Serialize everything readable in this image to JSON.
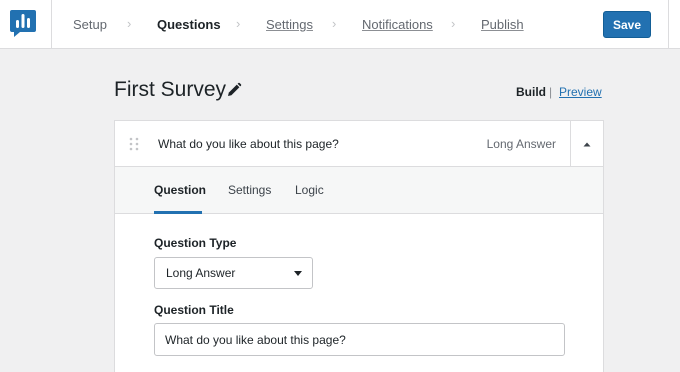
{
  "header": {
    "steps": [
      {
        "label": "Setup",
        "state": "done"
      },
      {
        "label": "Questions",
        "state": "active"
      },
      {
        "label": "Settings",
        "state": "link"
      },
      {
        "label": "Notifications",
        "state": "link"
      },
      {
        "label": "Publish",
        "state": "link"
      }
    ],
    "save_label": "Save",
    "logo_icon": "bar-chart-logo-icon",
    "step_separator_icon": "chevron-right-icon"
  },
  "survey": {
    "title": "First Survey",
    "edit_icon": "pencil-icon",
    "view_modes": {
      "build": "Build",
      "separator": "|",
      "preview": "Preview"
    }
  },
  "question": {
    "text": "What do you like about this page?",
    "type": "Long Answer",
    "drag_icon": "drag-handle-icon",
    "collapse_icon": "caret-up-icon",
    "tabs": [
      {
        "label": "Question",
        "active": true
      },
      {
        "label": "Settings",
        "active": false
      },
      {
        "label": "Logic",
        "active": false
      }
    ],
    "fields": {
      "type_label": "Question Type",
      "type_value": "Long Answer",
      "title_label": "Question Title",
      "title_value": "What do you like about this page?"
    }
  },
  "colors": {
    "accent": "#2271b1",
    "page_bg": "#f0f0f1",
    "border": "#dcdcde",
    "text": "#1d2327",
    "muted": "#646970"
  }
}
